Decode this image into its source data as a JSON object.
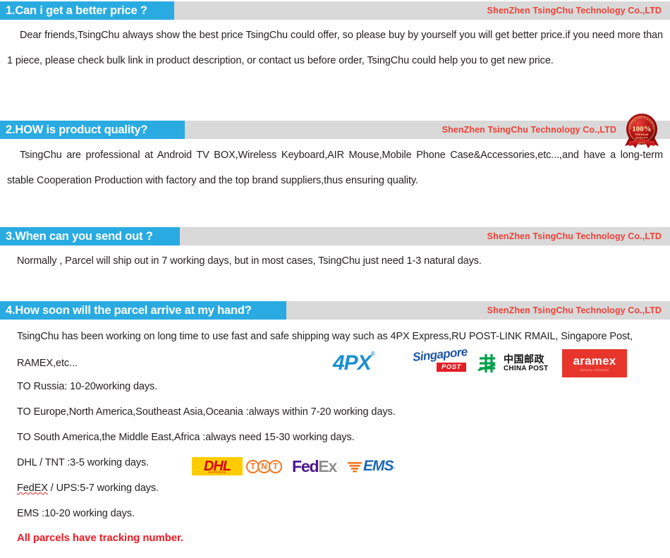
{
  "company_label": "ShenZhen TsingChu Technology Co.,LTD",
  "sections": [
    {
      "heading": "1.Can i get a better price ?",
      "company": "ShenZhen TsingChu Technology Co.,LTD",
      "paragraphs": [
        "Dear friends,TsingChu always show the best price TsingChu could offer, so please buy by yourself you will get better price.if you need more than 1 piece, please check bulk link in product description, or contact us before order, TsingChu could help you to get new price."
      ]
    },
    {
      "heading": "2.HOW is product quality?",
      "company": "ShenZhen TsingChu Technology Co.,LTD",
      "paragraphs": [
        "TsingChu are professional at Android TV BOX,Wireless Keyboard,AIR Mouse,Mobile Phone Case&Accessories,etc...,and have a long-term stable Cooperation Production with factory and the top brand suppliers,thus ensuring quality."
      ]
    },
    {
      "heading": "3.When can you send out ?",
      "company": "ShenZhen TsingChu Technology Co.,LTD",
      "paragraphs": [
        "Normally , Parcel will ship out in 7 working days, but in most cases, TsingChu just need 1-3 natural days."
      ]
    },
    {
      "heading": "4.How soon will the parcel arrive at my hand?",
      "company": "ShenZhen TsingChu Technology Co.,LTD",
      "paragraphs": [
        "TsingChu has been working on long time to use fast and safe shipping way such as 4PX Express,RU POST-LINK RMAIL, Singapore Post, RAMEX,etc...",
        "TO Russia: 10-20working days.",
        "TO Europe,North America,Southeast Asia,Oceania :always within 7-20 working days.",
        "TO South America,the Middle East,Africa :always need 15-30 working days.",
        "EMS :10-20 working days."
      ],
      "dhl_tnt_line": "DHL / TNT :3-5 working days.",
      "fedex_line_a": "FedEX",
      "fedex_line_b": " / UPS:5-7 working days.",
      "tracking_note": "All parcels have tracking number."
    }
  ],
  "quality_seal": {
    "percent": "100%",
    "top_arc": "SATISFACTION GUARANTEE",
    "line1": "PREMIUM",
    "line2": "QUALITY",
    "ribbon": "BEST"
  },
  "logos_row1": [
    {
      "name": "4px-logo",
      "text": "4PX",
      "mark": "®",
      "color": "#1a8fd1"
    },
    {
      "name": "singapore-post-logo",
      "script": "Singapore",
      "post": "POST",
      "color": "#1f56a5",
      "accent": "#e31e24"
    },
    {
      "name": "china-post-logo",
      "cn": "中国邮政",
      "en": "CHINA POST",
      "color": "#00a04a"
    },
    {
      "name": "aramex-logo",
      "text": "aramex",
      "tagline": "delivery unlimited",
      "color": "#e8352b"
    }
  ],
  "logos_row2": [
    {
      "name": "dhl-logo",
      "text": "DHL",
      "sub": "EXPRESS",
      "bg": "#ffcc00",
      "color": "#d40511"
    },
    {
      "name": "tnt-logo",
      "letters": [
        "T",
        "N",
        "T"
      ],
      "color": "#f47721"
    },
    {
      "name": "fedex-logo",
      "part1": "Fed",
      "part2": "Ex",
      "color1": "#4d148c",
      "color2": "#8e8e8e"
    },
    {
      "name": "ems-logo",
      "text": "EMS",
      "color": "#1b68b3",
      "accent": "#f47721"
    }
  ],
  "colors": {
    "tab_blue": "#29ABE2",
    "bar_gray": "#d9d9d9",
    "company_red": "#ef4136",
    "text_dark": "#231f20",
    "tracking_red": "#ed1c24"
  }
}
